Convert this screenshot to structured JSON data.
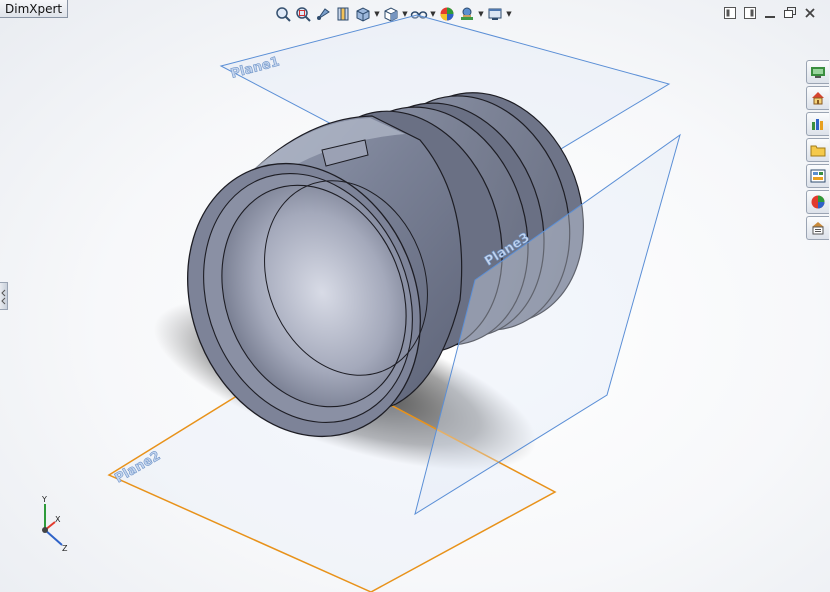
{
  "dimxpert_tab": {
    "label": "DimXpert"
  },
  "view_toolbar": {
    "buttons": [
      "zoom-to-fit-icon",
      "zoom-to-area-icon",
      "previous-view-icon",
      "section-view-icon",
      "view-orientation-icon",
      "display-style-icon",
      "hide-show-items-icon",
      "edit-appearance-icon",
      "apply-scene-icon",
      "view-settings-icon"
    ]
  },
  "window_controls": [
    "tile-left-icon",
    "tile-right-icon",
    "minimize-icon",
    "restore-icon",
    "close-icon"
  ],
  "task_pane": [
    "solidworks-resources-icon",
    "home-icon",
    "design-library-icon",
    "file-explorer-icon",
    "view-palette-icon",
    "appearances-icon",
    "custom-properties-icon"
  ],
  "planes": {
    "plane1": {
      "label": "Plane1",
      "color": "#5b8fd6"
    },
    "plane2": {
      "label": "Plane2",
      "color": "#e8921a"
    },
    "plane3": {
      "label": "Plane3",
      "color": "#5b8fd6"
    }
  },
  "triad": {
    "x_label": "X",
    "y_label": "Y",
    "z_label": "Z"
  }
}
